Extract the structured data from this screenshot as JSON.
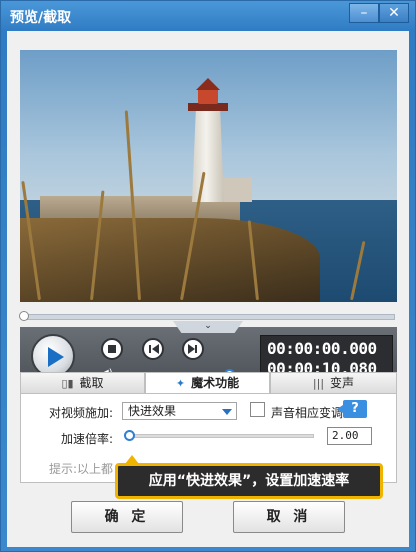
{
  "window": {
    "title": "预览/截取",
    "minimize_label": "–",
    "close_label": "✕"
  },
  "player": {
    "current_time": "00:00:00.000",
    "total_time": "00:00:10.080",
    "progress": 0.0,
    "volume": 1.0,
    "handle_glyph": "⌄",
    "volume_glyph": "◀)"
  },
  "tabs": [
    {
      "label": "截取",
      "icon": "crop-icon",
      "glyph": "▯▮",
      "active": false
    },
    {
      "label": "魔术功能",
      "icon": "magic-wand-icon",
      "glyph": "✦",
      "active": true
    },
    {
      "label": "变声",
      "icon": "audio-wave-icon",
      "glyph": "|||",
      "active": false
    }
  ],
  "magic": {
    "apply_label": "对视频施加:",
    "effect_value": "快进效果",
    "pitch_label": "声音相应变调",
    "pitch_checked": false,
    "help_label": "?",
    "rate_label": "加速倍率:",
    "rate_value": "2.00",
    "rate_slider": 0.0,
    "hint_text": "提示:以上都"
  },
  "callout": {
    "text": "应用“快进效果”，设置加速速率",
    "border_color": "#f0b400"
  },
  "buttons": {
    "ok_label": "确 定",
    "cancel_label": "取 消"
  }
}
